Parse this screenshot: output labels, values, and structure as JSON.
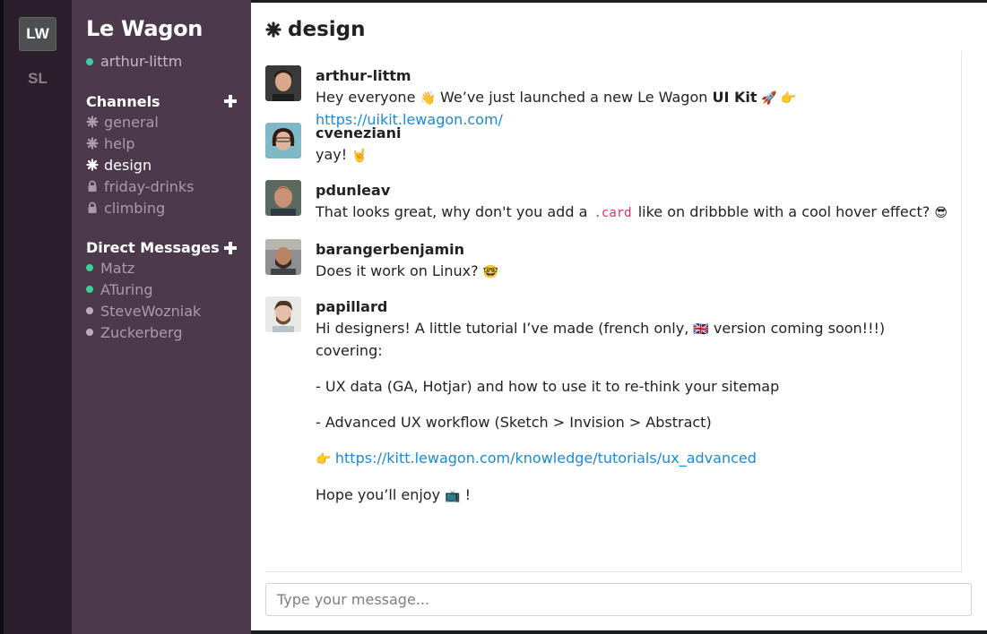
{
  "teams": {
    "active": "LW",
    "other": "SL"
  },
  "sidebar": {
    "title": "Le Wagon",
    "current_user": "arthur-littm",
    "channels_title": "Channels",
    "channels": [
      {
        "label": "general",
        "type": "public",
        "active": false
      },
      {
        "label": "help",
        "type": "public",
        "active": false
      },
      {
        "label": "design",
        "type": "public",
        "active": true
      },
      {
        "label": "friday-drinks",
        "type": "private",
        "active": false
      },
      {
        "label": "climbing",
        "type": "private",
        "active": false
      }
    ],
    "dm_title": "Direct Messages",
    "direct_messages": [
      {
        "label": "Matz",
        "status": "online"
      },
      {
        "label": "ATuring",
        "status": "online"
      },
      {
        "label": "SteveWozniak",
        "status": "offline"
      },
      {
        "label": "Zuckerberg",
        "status": "offline"
      }
    ]
  },
  "channel": {
    "name": "design"
  },
  "messages": [
    {
      "author": "arthur-littm",
      "p1": "Hey everyone ",
      "e1": "👋",
      "p2": " We’ve just launched a new Le Wagon ",
      "strong": "UI Kit",
      "e2": " 🚀 👉 ",
      "link": "https://uikit.lewagon.com/"
    },
    {
      "author": "cveneziani",
      "p1": "yay! ",
      "e1": "🤘"
    },
    {
      "author": "pdunleav",
      "p1": "That looks great, why don't you add a ",
      "code": ".card",
      "p2": " like on dribbble with a cool hover effect? ",
      "e1": "😎"
    },
    {
      "author": "barangerbenjamin",
      "p1": "Does it work on Linux? ",
      "e1": "🤓"
    },
    {
      "author": "papillard",
      "line1a": "Hi designers! A little tutorial I’ve made (french only, ",
      "flag": "🇬🇧",
      "line1b": " version coming soon!!!) covering:",
      "line2": "- UX data (GA, Hotjar) and how to use it to re-think your sitemap",
      "line3": "- Advanced UX workflow (Sketch > Invision > Abstract)",
      "e_point": "👉 ",
      "link": "https://kitt.lewagon.com/knowledge/tutorials/ux_advanced",
      "line5a": "Hope you’ll enjoy ",
      "e_tv": "📺",
      "line5b": " !"
    }
  ],
  "composer": {
    "placeholder": "Type your message..."
  },
  "colors": {
    "team_bar": "#2a1f2b",
    "sidebar": "#4c3a4c",
    "online": "#3ecf9e",
    "link": "#1a8ad6",
    "code": "#d6336c"
  }
}
